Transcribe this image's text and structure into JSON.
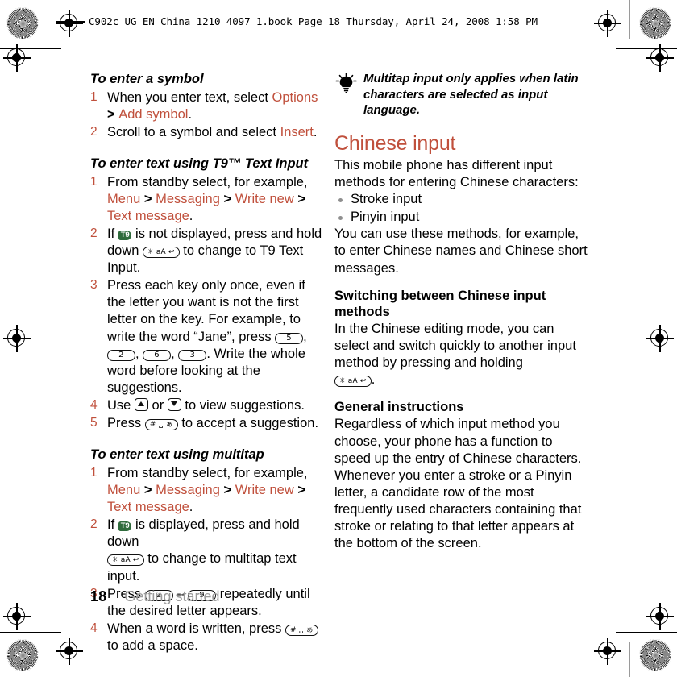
{
  "running_head": "C902c_UG_EN China_1210_4097_1.book  Page 18  Thursday, April 24, 2008  1:58 PM",
  "colors": {
    "accent": "#c0503c",
    "t9_badge": "#2f6b3c",
    "footer_chapter": "#9a9a9a",
    "bullet": "#8f8f8f"
  },
  "left_column": {
    "symbol_section": {
      "heading": "To enter a symbol",
      "steps": [
        {
          "parts": [
            {
              "t": "When you enter text, select ",
              "style": "plain"
            },
            {
              "t": "Options",
              "style": "link"
            },
            {
              "t": " > ",
              "style": "sep"
            },
            {
              "t": "Add symbol",
              "style": "link"
            },
            {
              "t": ".",
              "style": "plain"
            }
          ]
        },
        {
          "parts": [
            {
              "t": "Scroll to a symbol and select ",
              "style": "plain"
            },
            {
              "t": "Insert",
              "style": "link"
            },
            {
              "t": ".",
              "style": "plain"
            }
          ]
        }
      ]
    },
    "t9_section": {
      "heading": "To enter text using T9™ Text Input",
      "step1_prefix": "From standby select, for example,",
      "path": [
        "Menu",
        "Messaging",
        "Write new",
        "Text message"
      ],
      "step2_a": "If ",
      "step2_b": " is not displayed, press and hold down ",
      "step2_c": " to change to T9 Text Input.",
      "step3_a": "Press each key only once, even if the letter you want is not the first letter on the key. For example, to write the word “Jane”, press ",
      "step3_keys": [
        "5",
        "2",
        "6",
        "3"
      ],
      "step3_b": ". Write the whole word before looking at the suggestions.",
      "step4_a": "Use ",
      "step4_b": " or ",
      "step4_c": " to view suggestions.",
      "step5_a": "Press ",
      "step5_b": " to accept a suggestion."
    },
    "multitap_section": {
      "heading": "To enter text using multitap",
      "step1_prefix": "From standby select, for example,",
      "path": [
        "Menu",
        "Messaging",
        "Write new",
        "Text message"
      ],
      "step2_a": "If ",
      "step2_b": " is displayed, press and hold down ",
      "step2_c": " to change to multitap text input.",
      "step3_a": "Press ",
      "step3_key_from": "2",
      "step3_dash": " – ",
      "step3_key_to": "9",
      "step3_b": " repeatedly until the desired letter appears.",
      "step4_a": "When a word is written, press ",
      "step4_b": " to add a space."
    }
  },
  "right_column": {
    "tip": "Multitap input only applies when latin characters are selected as input language.",
    "chinese_input": {
      "heading": "Chinese input",
      "intro": "This mobile phone has different input methods for entering Chinese characters:",
      "methods": [
        "Stroke input",
        "Pinyin input"
      ],
      "usage": "You can use these methods, for example, to enter Chinese names and Chinese short messages."
    },
    "switching": {
      "heading": "Switching between Chinese input methods",
      "body_a": "In the Chinese editing mode, you can select and switch quickly to another input method by pressing and holding ",
      "body_b": "."
    },
    "general": {
      "heading": "General instructions",
      "body": "Regardless of which input method you choose, your phone has a function to speed up the entry of Chinese characters. Whenever you enter a stroke or a Pinyin letter, a candidate row of the most frequently used characters containing that stroke or relating to that letter appears at the bottom of the screen."
    }
  },
  "keys": {
    "star": "✳ aA ↩",
    "hash": "# ␣ ぁ",
    "t9_badge_label": "T9",
    "nav_up": "up-arrow-key",
    "nav_down": "down-arrow-key"
  },
  "footer": {
    "page_number": "18",
    "chapter": "Getting started"
  }
}
